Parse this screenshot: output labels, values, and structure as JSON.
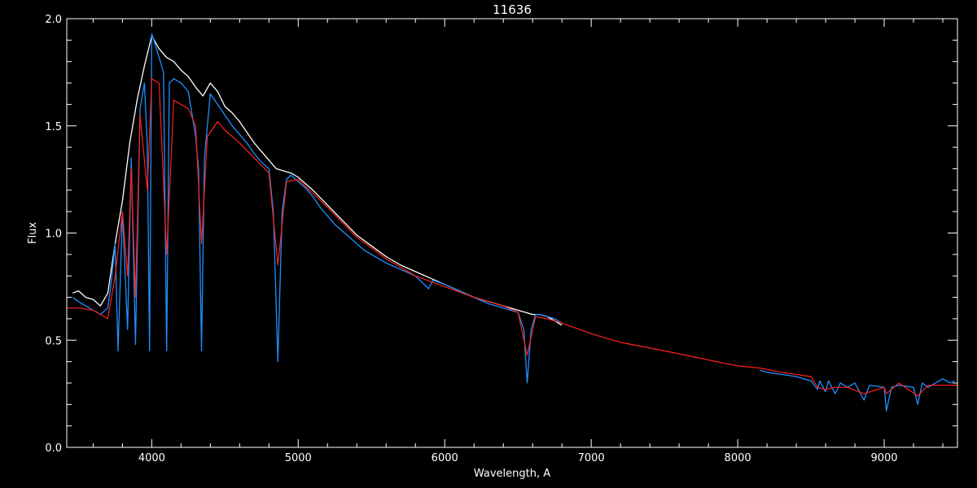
{
  "chart_data": {
    "type": "line",
    "title": "11636",
    "xlabel": "Wavelength, A",
    "ylabel": "Flux",
    "xlim": [
      3420,
      9500
    ],
    "ylim": [
      0.0,
      2.0
    ],
    "x_ticks": [
      4000,
      5000,
      6000,
      7000,
      8000,
      9000
    ],
    "y_ticks": [
      "0.0",
      "0.5",
      "1.0",
      "1.5",
      "2.0"
    ],
    "x_minor_step": 200,
    "y_minor_step": 0.1,
    "grid": false,
    "background": "#000000",
    "axis_color": "#ffffff",
    "series": [
      {
        "color": "#ffffff",
        "x": [
          3460,
          3500,
          3550,
          3600,
          3650,
          3700,
          3750,
          3800,
          3850,
          3900,
          3950,
          4000,
          4050,
          4100,
          4150,
          4200,
          4250,
          4300,
          4350,
          4400,
          4450,
          4500,
          4550,
          4600,
          4650,
          4700,
          4750,
          4800,
          4850,
          4900,
          4950,
          5000,
          5100,
          5200,
          5300,
          5400,
          5500,
          5600,
          5700,
          5800,
          5900,
          6000,
          6100,
          6200,
          6300,
          6400,
          6500,
          6600,
          6650,
          6700,
          6750,
          6800
        ],
        "y": [
          0.72,
          0.73,
          0.7,
          0.69,
          0.66,
          0.72,
          0.95,
          1.15,
          1.42,
          1.62,
          1.78,
          1.92,
          1.86,
          1.82,
          1.8,
          1.76,
          1.73,
          1.68,
          1.64,
          1.7,
          1.66,
          1.59,
          1.56,
          1.52,
          1.47,
          1.42,
          1.38,
          1.34,
          1.3,
          1.29,
          1.28,
          1.26,
          1.2,
          1.13,
          1.06,
          0.99,
          0.94,
          0.89,
          0.85,
          0.82,
          0.79,
          0.76,
          0.73,
          0.7,
          0.68,
          0.66,
          0.64,
          0.62,
          0.62,
          0.61,
          0.59,
          0.57
        ]
      },
      {
        "color": "#1e90ff",
        "x": [
          3460,
          3500,
          3550,
          3600,
          3650,
          3700,
          3720,
          3750,
          3770,
          3800,
          3835,
          3860,
          3889,
          3920,
          3950,
          3970,
          3985,
          4000,
          4050,
          4080,
          4102,
          4120,
          4150,
          4200,
          4250,
          4300,
          4320,
          4340,
          4360,
          4400,
          4450,
          4500,
          4550,
          4600,
          4650,
          4700,
          4750,
          4800,
          4830,
          4861,
          4890,
          4920,
          4950,
          5000,
          5050,
          5100,
          5150,
          5200,
          5250,
          5300,
          5350,
          5400,
          5450,
          5500,
          5600,
          5700,
          5800,
          5890,
          5920,
          6000,
          6100,
          6200,
          6300,
          6400,
          6500,
          6540,
          6563,
          6590,
          6620,
          6650,
          6700,
          6750,
          6800,
          8150,
          8200,
          8300,
          8400,
          8450,
          8500,
          8545,
          8560,
          8598,
          8620,
          8665,
          8700,
          8750,
          8800,
          8862,
          8900,
          9000,
          9015,
          9050,
          9100,
          9200,
          9229,
          9260,
          9300,
          9400,
          9450,
          9480
        ],
        "y": [
          0.7,
          0.68,
          0.66,
          0.64,
          0.62,
          0.65,
          0.75,
          0.95,
          0.45,
          1.1,
          0.55,
          1.35,
          0.48,
          1.58,
          1.7,
          1.4,
          0.45,
          1.93,
          1.82,
          1.75,
          0.45,
          1.7,
          1.72,
          1.7,
          1.66,
          1.45,
          1.3,
          0.45,
          1.35,
          1.65,
          1.6,
          1.55,
          1.5,
          1.46,
          1.42,
          1.37,
          1.33,
          1.3,
          1.1,
          0.4,
          1.1,
          1.25,
          1.27,
          1.24,
          1.21,
          1.17,
          1.12,
          1.08,
          1.04,
          1.01,
          0.98,
          0.95,
          0.92,
          0.9,
          0.86,
          0.83,
          0.8,
          0.74,
          0.78,
          0.76,
          0.73,
          0.7,
          0.67,
          0.65,
          0.63,
          0.55,
          0.3,
          0.55,
          0.62,
          0.62,
          0.61,
          0.6,
          0.58,
          0.36,
          0.35,
          0.34,
          0.33,
          0.32,
          0.31,
          0.27,
          0.31,
          0.26,
          0.31,
          0.25,
          0.3,
          0.28,
          0.3,
          0.22,
          0.29,
          0.28,
          0.17,
          0.28,
          0.29,
          0.28,
          0.2,
          0.3,
          0.28,
          0.32,
          0.3,
          0.31
        ]
      },
      {
        "color": "#ff2020",
        "x": [
          3420,
          3500,
          3600,
          3650,
          3700,
          3750,
          3800,
          3835,
          3860,
          3889,
          3920,
          3970,
          4000,
          4050,
          4102,
          4150,
          4200,
          4250,
          4300,
          4340,
          4380,
          4450,
          4500,
          4600,
          4700,
          4800,
          4861,
          4920,
          5000,
          5200,
          5400,
          5600,
          5800,
          6000,
          6200,
          6400,
          6500,
          6563,
          6620,
          6700,
          6800,
          7000,
          7200,
          7500,
          8000,
          8150,
          8300,
          8500,
          8545,
          8598,
          8665,
          8750,
          8862,
          9000,
          9015,
          9100,
          9229,
          9300,
          9400,
          9500
        ],
        "y": [
          0.65,
          0.65,
          0.64,
          0.62,
          0.6,
          0.8,
          1.1,
          0.8,
          1.3,
          0.7,
          1.55,
          1.2,
          1.72,
          1.7,
          0.9,
          1.62,
          1.6,
          1.58,
          1.5,
          0.95,
          1.45,
          1.52,
          1.48,
          1.42,
          1.35,
          1.28,
          0.85,
          1.24,
          1.25,
          1.12,
          0.98,
          0.88,
          0.8,
          0.75,
          0.7,
          0.66,
          0.63,
          0.43,
          0.61,
          0.6,
          0.58,
          0.53,
          0.49,
          0.45,
          0.38,
          0.37,
          0.35,
          0.33,
          0.28,
          0.27,
          0.28,
          0.28,
          0.25,
          0.28,
          0.25,
          0.3,
          0.24,
          0.29,
          0.29,
          0.29
        ]
      }
    ]
  }
}
